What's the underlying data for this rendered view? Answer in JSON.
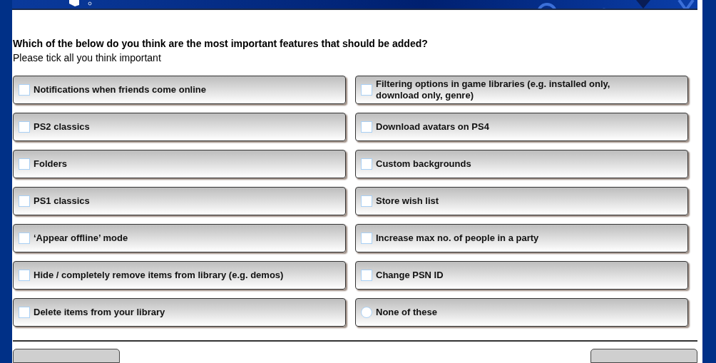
{
  "question": {
    "title": "Which of the below do you think are the most important features that should be added?",
    "hint": "Please tick all you think important"
  },
  "options": [
    {
      "label": "Notifications when friends come online",
      "kind": "checkbox",
      "checked": false
    },
    {
      "label": "PS2 classics",
      "kind": "checkbox",
      "checked": false
    },
    {
      "label": "Folders",
      "kind": "checkbox",
      "checked": false
    },
    {
      "label": "PS1 classics",
      "kind": "checkbox",
      "checked": false
    },
    {
      "label": "‘Appear offline’ mode",
      "kind": "checkbox",
      "checked": false
    },
    {
      "label": "Hide / completely remove items from library (e.g. demos)",
      "kind": "checkbox",
      "checked": false
    },
    {
      "label": "Delete items from your library",
      "kind": "checkbox",
      "checked": false
    },
    {
      "label": "Filtering options in game libraries (e.g. installed only, download only, genre)",
      "kind": "checkbox",
      "checked": false
    },
    {
      "label": "Download avatars on PS4",
      "kind": "checkbox",
      "checked": false
    },
    {
      "label": "Custom backgrounds",
      "kind": "checkbox",
      "checked": false
    },
    {
      "label": "Store wish list",
      "kind": "checkbox",
      "checked": false
    },
    {
      "label": "Increase max no. of people in a party",
      "kind": "checkbox",
      "checked": false
    },
    {
      "label": "Change PSN ID",
      "kind": "checkbox",
      "checked": false
    },
    {
      "label": "None of these",
      "kind": "radio",
      "checked": false
    }
  ]
}
